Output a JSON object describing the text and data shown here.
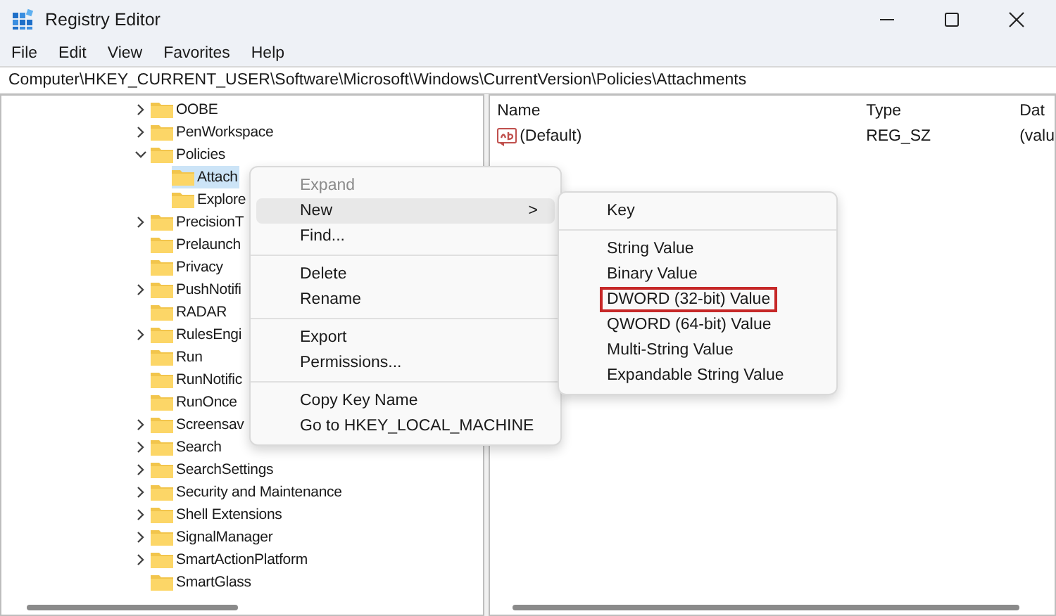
{
  "window": {
    "title": "Registry Editor"
  },
  "menu_bar": [
    "File",
    "Edit",
    "View",
    "Favorites",
    "Help"
  ],
  "address_bar": "Computer\\HKEY_CURRENT_USER\\Software\\Microsoft\\Windows\\CurrentVersion\\Policies\\Attachments",
  "tree": [
    {
      "label": "OOBE",
      "expandable": true,
      "expanded": false,
      "selected": false
    },
    {
      "label": "PenWorkspace",
      "expandable": true,
      "expanded": false,
      "selected": false
    },
    {
      "label": "Policies",
      "expandable": true,
      "expanded": true,
      "selected": false,
      "children": [
        {
          "label": "Attach",
          "expandable": false,
          "selected": true
        },
        {
          "label": "Explore",
          "expandable": false,
          "selected": false
        }
      ]
    },
    {
      "label": "PrecisionT",
      "expandable": true,
      "expanded": false,
      "selected": false
    },
    {
      "label": "Prelaunch",
      "expandable": false,
      "selected": false
    },
    {
      "label": "Privacy",
      "expandable": false,
      "selected": false
    },
    {
      "label": "PushNotifi",
      "expandable": true,
      "expanded": false,
      "selected": false
    },
    {
      "label": "RADAR",
      "expandable": false,
      "selected": false
    },
    {
      "label": "RulesEngi",
      "expandable": true,
      "expanded": false,
      "selected": false
    },
    {
      "label": "Run",
      "expandable": false,
      "selected": false
    },
    {
      "label": "RunNotific",
      "expandable": false,
      "selected": false
    },
    {
      "label": "RunOnce",
      "expandable": false,
      "selected": false
    },
    {
      "label": "Screensav",
      "expandable": true,
      "expanded": false,
      "selected": false
    },
    {
      "label": "Search",
      "expandable": true,
      "expanded": false,
      "selected": false
    },
    {
      "label": "SearchSettings",
      "expandable": true,
      "expanded": false,
      "selected": false
    },
    {
      "label": "Security and Maintenance",
      "expandable": true,
      "expanded": false,
      "selected": false
    },
    {
      "label": "Shell Extensions",
      "expandable": true,
      "expanded": false,
      "selected": false
    },
    {
      "label": "SignalManager",
      "expandable": true,
      "expanded": false,
      "selected": false
    },
    {
      "label": "SmartActionPlatform",
      "expandable": true,
      "expanded": false,
      "selected": false
    },
    {
      "label": "SmartGlass",
      "expandable": false,
      "selected": false
    }
  ],
  "values_table": {
    "columns": [
      "Name",
      "Type",
      "Dat"
    ],
    "rows": [
      {
        "name": "(Default)",
        "type": "REG_SZ",
        "data": "(valu"
      }
    ]
  },
  "context_menu": [
    {
      "kind": "item",
      "label": "Expand",
      "disabled": true,
      "highlighted": false
    },
    {
      "kind": "item",
      "label": "New",
      "disabled": false,
      "highlighted": true,
      "arrow": ">"
    },
    {
      "kind": "item",
      "label": "Find...",
      "disabled": false,
      "highlighted": false
    },
    {
      "kind": "separator"
    },
    {
      "kind": "item",
      "label": "Delete",
      "disabled": false,
      "highlighted": false
    },
    {
      "kind": "item",
      "label": "Rename",
      "disabled": false,
      "highlighted": false
    },
    {
      "kind": "separator"
    },
    {
      "kind": "item",
      "label": "Export",
      "disabled": false,
      "highlighted": false
    },
    {
      "kind": "item",
      "label": "Permissions...",
      "disabled": false,
      "highlighted": false
    },
    {
      "kind": "separator"
    },
    {
      "kind": "item",
      "label": "Copy Key Name",
      "disabled": false,
      "highlighted": false
    },
    {
      "kind": "item",
      "label": "Go to HKEY_LOCAL_MACHINE",
      "disabled": false,
      "highlighted": false
    }
  ],
  "submenu": [
    {
      "kind": "item",
      "label": "Key",
      "outlined": false
    },
    {
      "kind": "separator"
    },
    {
      "kind": "item",
      "label": "String Value",
      "outlined": false
    },
    {
      "kind": "item",
      "label": "Binary Value",
      "outlined": false
    },
    {
      "kind": "item",
      "label": "DWORD (32-bit) Value",
      "outlined": true
    },
    {
      "kind": "item",
      "label": "QWORD (64-bit) Value",
      "outlined": false
    },
    {
      "kind": "item",
      "label": "Multi-String Value",
      "outlined": false
    },
    {
      "kind": "item",
      "label": "Expandable String Value",
      "outlined": false
    }
  ]
}
